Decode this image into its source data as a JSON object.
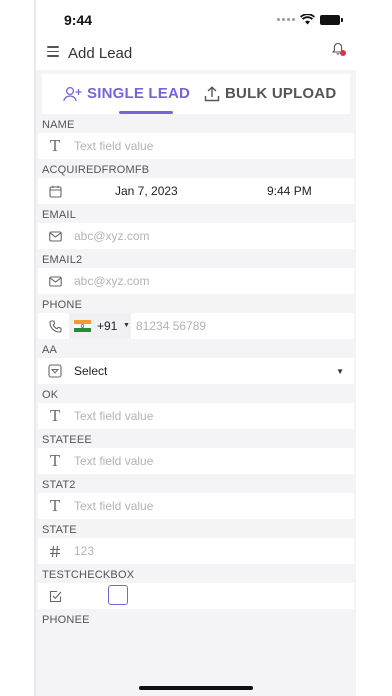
{
  "status": {
    "time": "9:44"
  },
  "appbar": {
    "title": "Add Lead"
  },
  "tabs": {
    "single": "SINGLE LEAD",
    "bulk": "BULK UPLOAD"
  },
  "fields": {
    "name": {
      "label": "NAME",
      "placeholder": "Text field value"
    },
    "acquired": {
      "label": "ACQUIREDFROMFB",
      "date": "Jan 7, 2023",
      "time": "9:44 PM"
    },
    "email": {
      "label": "EMAIL",
      "placeholder": "abc@xyz.com"
    },
    "email2": {
      "label": "EMAIL2",
      "placeholder": "abc@xyz.com"
    },
    "phone": {
      "label": "PHONE",
      "code": "+91",
      "placeholder": "81234 56789"
    },
    "aa": {
      "label": "AA",
      "value": "Select"
    },
    "ok": {
      "label": "OK",
      "placeholder": "Text field value"
    },
    "stateee": {
      "label": "STATEEE",
      "placeholder": "Text field value"
    },
    "stat2": {
      "label": "STAT2",
      "placeholder": "Text field value"
    },
    "state": {
      "label": "STATE",
      "placeholder": "123"
    },
    "testcheckbox": {
      "label": "TESTCHECKBOX"
    },
    "phonee": {
      "label": "PHONEE"
    }
  },
  "colors": {
    "accent": "#7a63d6",
    "notification": "#d9354f",
    "background": "#f4f4f6"
  },
  "icons": {
    "menu": "hamburger-icon",
    "bell": "bell-icon",
    "single": "person-add-icon",
    "bulk": "upload-icon",
    "text": "text-type-icon",
    "calendar": "calendar-icon",
    "email": "mail-icon",
    "phone": "phone-icon",
    "select": "dropdown-icon",
    "number": "hash-icon",
    "checkbox": "checkbox-icon"
  }
}
